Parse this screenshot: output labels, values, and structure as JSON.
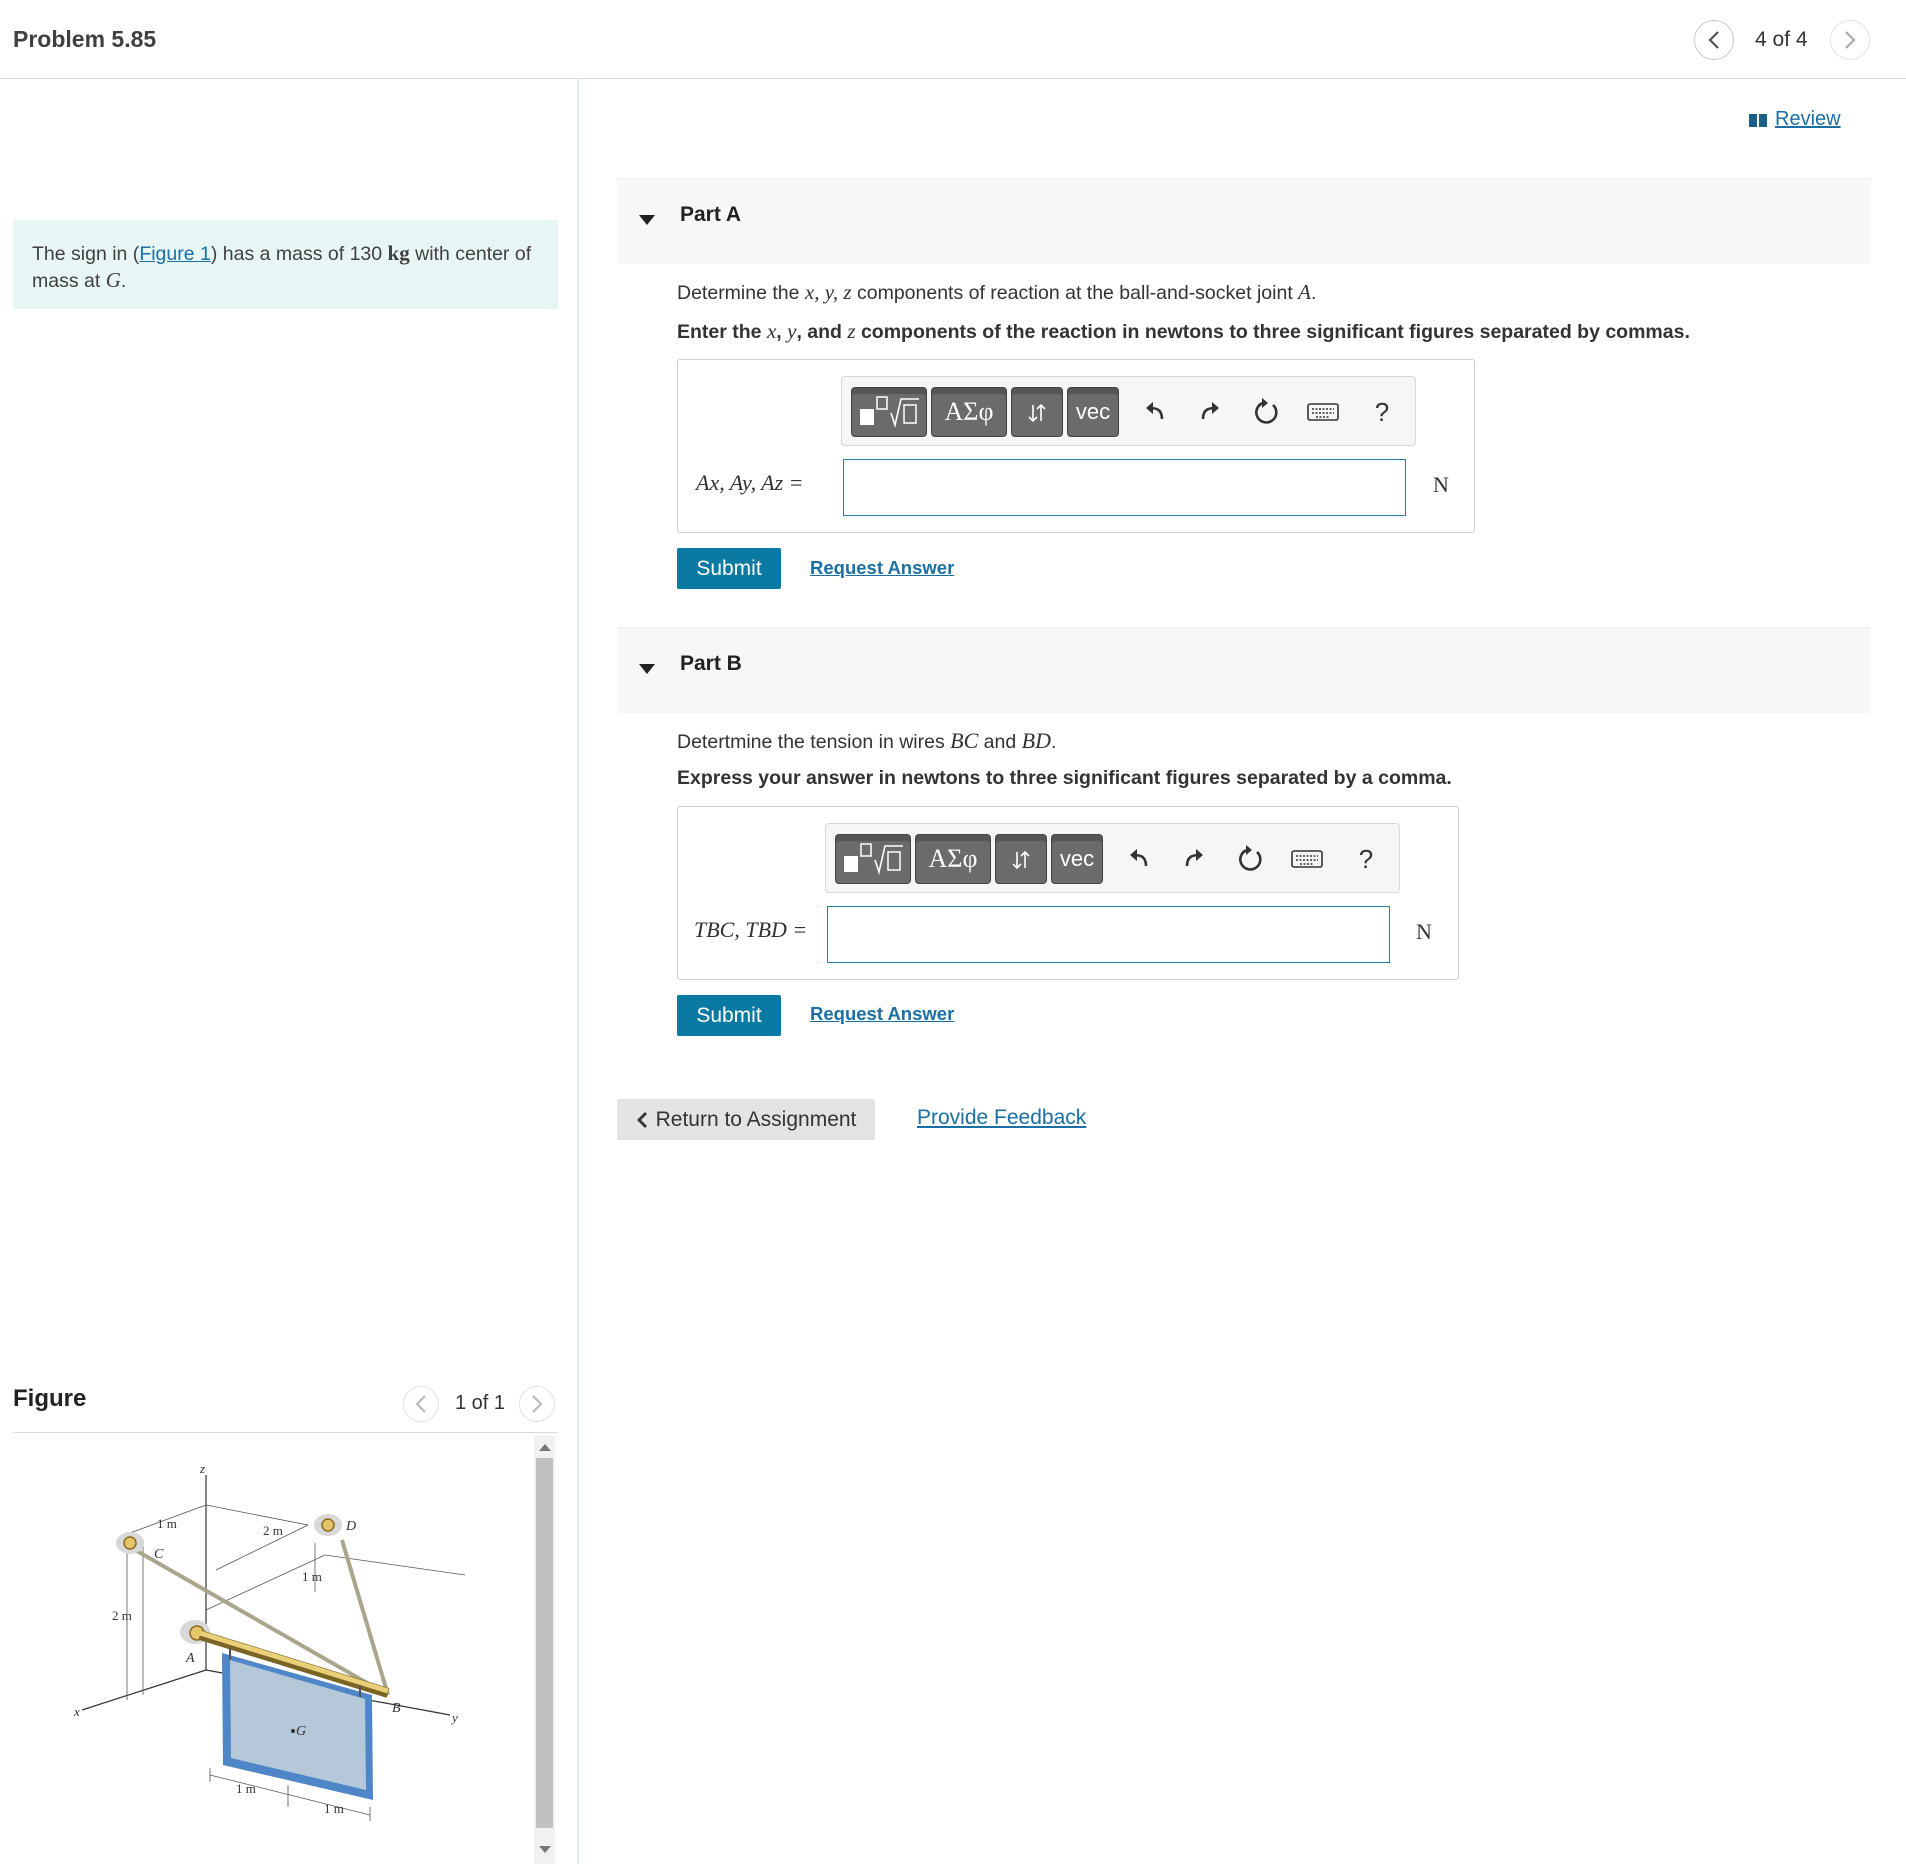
{
  "header": {
    "title": "Problem 5.85",
    "position": "4 of 4"
  },
  "intro": {
    "pre": "The sign in (",
    "figure_link": "Figure 1",
    "mid": ") has a mass of 130 ",
    "unit": "kg",
    "post": " with center of mass at ",
    "point": "G",
    "end": "."
  },
  "review_label": "Review",
  "figure": {
    "title": "Figure",
    "count": "1 of 1",
    "labels": {
      "z": "z",
      "x": "x",
      "y": "y",
      "A": "A",
      "B": "B",
      "C": "C",
      "D": "D",
      "G": "G",
      "dim_1m_top": "1 m",
      "dim_2m_top": "2 m",
      "dim_1m_right": "1 m",
      "dim_2m_left": "2 m",
      "dim_1m_bottom_a": "1 m",
      "dim_1m_bottom_b": "1 m"
    }
  },
  "part_a": {
    "title": "Part A",
    "question_pre": "Determine the ",
    "question_vars": "x, y, z",
    "question_post": " components of reaction at the ball-and-socket joint ",
    "question_point": "A",
    "question_end": ".",
    "instr_pre": "Enter the ",
    "instr_x": "x",
    "instr_sep1": ", ",
    "instr_y": "y",
    "instr_and": ", and ",
    "instr_z": "z",
    "instr_post": " components of the reaction in newtons to three significant figures separated by commas.",
    "answer_label": "Ax, Ay, Az =",
    "answer_value": "",
    "unit": "N",
    "submit": "Submit",
    "request": "Request Answer"
  },
  "part_b": {
    "title": "Part B",
    "question_pre": "Detertmine the tension in wires ",
    "question_w1": "BC",
    "question_and": " and ",
    "question_w2": "BD",
    "question_end": ".",
    "instr": "Express your answer in newtons to three significant figures separated by a comma.",
    "answer_label": "TBC, TBD =",
    "answer_value": "",
    "unit": "N",
    "submit": "Submit",
    "request": "Request Answer"
  },
  "toolbar": {
    "greek": "ΑΣφ",
    "vec": "vec",
    "help": "?"
  },
  "footer": {
    "return": "Return to Assignment",
    "feedback": "Provide Feedback"
  },
  "colors": {
    "accent": "#0a7aa3",
    "link": "#1a6fa3",
    "intro_bg": "#e8f5f5"
  }
}
